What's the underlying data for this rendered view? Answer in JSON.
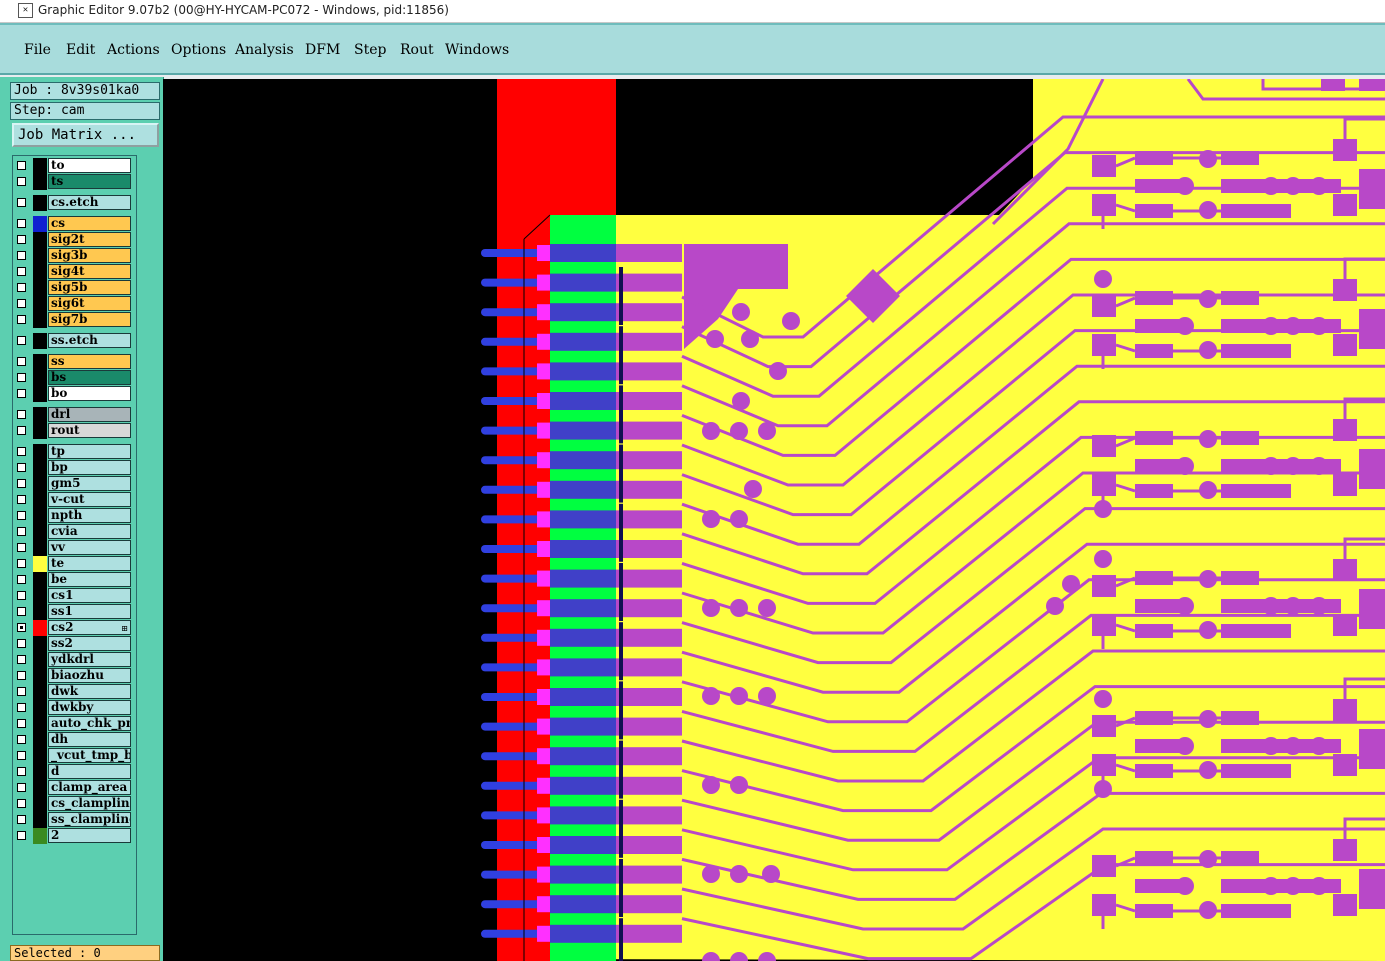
{
  "window": {
    "title": "Graphic Editor 9.07b2 (00@HY-HYCAM-PC072 - Windows, pid:11856)"
  },
  "menu": [
    {
      "label": "File"
    },
    {
      "label": "Edit"
    },
    {
      "label": "Actions"
    },
    {
      "label": "Options"
    },
    {
      "label": "Analysis"
    },
    {
      "label": "DFM"
    },
    {
      "label": "Step"
    },
    {
      "label": "Rout"
    },
    {
      "label": "Windows"
    }
  ],
  "job": {
    "job_line": "Job : 8v39s01ka0",
    "step_line": "Step: cam",
    "matrix_button": "Job Matrix ..."
  },
  "layers": [
    {
      "name": "to",
      "bg": "#ffffff",
      "swatch": "#000000",
      "checked": false
    },
    {
      "name": "ts",
      "bg": "#1a8a6a",
      "swatch": "#000000",
      "checked": false
    },
    {
      "name": "cs.etch",
      "bg": "#aee0e0",
      "swatch": "#000000",
      "checked": false
    },
    {
      "name": "cs",
      "bg": "#ffc850",
      "swatch": "#1020d0",
      "checked": false
    },
    {
      "name": "sig2t",
      "bg": "#ffc850",
      "swatch": "#000000",
      "checked": false
    },
    {
      "name": "sig3b",
      "bg": "#ffc850",
      "swatch": "#000000",
      "checked": false
    },
    {
      "name": "sig4t",
      "bg": "#ffc850",
      "swatch": "#000000",
      "checked": false
    },
    {
      "name": "sig5b",
      "bg": "#ffc850",
      "swatch": "#000000",
      "checked": false
    },
    {
      "name": "sig6t",
      "bg": "#ffc850",
      "swatch": "#000000",
      "checked": false
    },
    {
      "name": "sig7b",
      "bg": "#ffc850",
      "swatch": "#000000",
      "checked": false
    },
    {
      "name": "ss.etch",
      "bg": "#aee0e0",
      "swatch": "#000000",
      "checked": false
    },
    {
      "name": "ss",
      "bg": "#ffc850",
      "swatch": "#000000",
      "checked": false
    },
    {
      "name": "bs",
      "bg": "#1a8a6a",
      "swatch": "#000000",
      "checked": false
    },
    {
      "name": "bo",
      "bg": "#ffffff",
      "swatch": "#000000",
      "checked": false
    },
    {
      "name": "drl",
      "bg": "#a8b4b8",
      "swatch": "#000000",
      "checked": false
    },
    {
      "name": "rout",
      "bg": "#d8d8d8",
      "swatch": "#000000",
      "checked": false
    },
    {
      "name": "tp",
      "bg": "#aee0e0",
      "swatch": "#000000",
      "checked": false
    },
    {
      "name": "bp",
      "bg": "#aee0e0",
      "swatch": "#000000",
      "checked": false
    },
    {
      "name": "gm5",
      "bg": "#aee0e0",
      "swatch": "#000000",
      "checked": false
    },
    {
      "name": "v-cut",
      "bg": "#aee0e0",
      "swatch": "#000000",
      "checked": false
    },
    {
      "name": "npth",
      "bg": "#aee0e0",
      "swatch": "#000000",
      "checked": false
    },
    {
      "name": "cvia",
      "bg": "#aee0e0",
      "swatch": "#000000",
      "checked": false
    },
    {
      "name": "vv",
      "bg": "#aee0e0",
      "swatch": "#000000",
      "checked": false
    },
    {
      "name": "te",
      "bg": "#aee0e0",
      "swatch": "#ffff40",
      "checked": false
    },
    {
      "name": "be",
      "bg": "#aee0e0",
      "swatch": "#000000",
      "checked": false
    },
    {
      "name": "cs1",
      "bg": "#aee0e0",
      "swatch": "#000000",
      "checked": false
    },
    {
      "name": "ss1",
      "bg": "#aee0e0",
      "swatch": "#000000",
      "checked": false
    },
    {
      "name": "cs2",
      "bg": "#aee0e0",
      "swatch": "#ff0000",
      "checked": true,
      "mark": "⊞"
    },
    {
      "name": "ss2",
      "bg": "#aee0e0",
      "swatch": "#000000",
      "checked": false
    },
    {
      "name": "ydkdrl",
      "bg": "#aee0e0",
      "swatch": "#000000",
      "checked": false
    },
    {
      "name": "biaozhu",
      "bg": "#aee0e0",
      "swatch": "#000000",
      "checked": false
    },
    {
      "name": "dwk",
      "bg": "#aee0e0",
      "swatch": "#000000",
      "checked": false
    },
    {
      "name": "dwkby",
      "bg": "#aee0e0",
      "swatch": "#000000",
      "checked": false
    },
    {
      "name": "auto_chk_pnl",
      "bg": "#aee0e0",
      "swatch": "#000000",
      "checked": false
    },
    {
      "name": "dh",
      "bg": "#aee0e0",
      "swatch": "#000000",
      "checked": false
    },
    {
      "name": "_vcut_tmp_ba",
      "bg": "#aee0e0",
      "swatch": "#000000",
      "checked": false
    },
    {
      "name": "d",
      "bg": "#aee0e0",
      "swatch": "#000000",
      "checked": false
    },
    {
      "name": "clamp_area",
      "bg": "#aee0e0",
      "swatch": "#000000",
      "checked": false
    },
    {
      "name": "cs_clampline",
      "bg": "#aee0e0",
      "swatch": "#000000",
      "checked": false
    },
    {
      "name": "ss_clampline",
      "bg": "#aee0e0",
      "swatch": "#000000",
      "checked": false
    },
    {
      "name": "2",
      "bg": "#aee0e0",
      "swatch": "#3a8a20",
      "checked": false
    }
  ],
  "status": {
    "selected": "Selected : 0"
  },
  "colors": {
    "board": "#ffff40",
    "copper": "#b848c8",
    "red_strip": "#ff0000",
    "green_strip": "#00ff40",
    "blue_pad": "#4040c8",
    "background": "#000000"
  }
}
